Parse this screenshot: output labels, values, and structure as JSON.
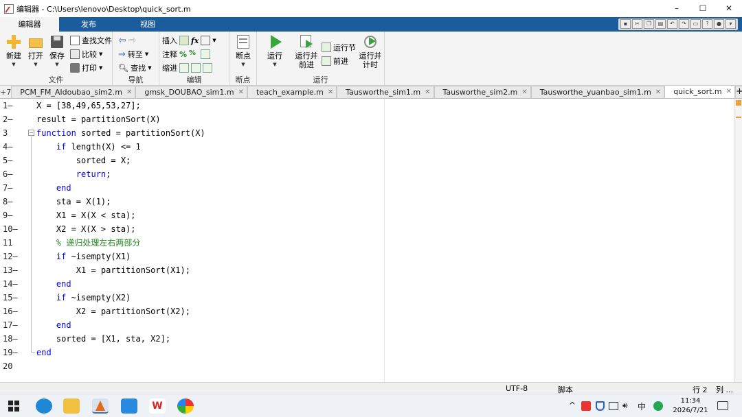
{
  "window": {
    "title": "编辑器 - C:\\Users\\lenovo\\Desktop\\quick_sort.m",
    "minimize": "–",
    "maximize": "☐",
    "close": "✕"
  },
  "ribbon_tabs": [
    {
      "label": "编辑器",
      "active": true
    },
    {
      "label": "发布",
      "active": false
    },
    {
      "label": "视图",
      "active": false
    }
  ],
  "ribbon": {
    "file": {
      "label": "文件",
      "new": "新建",
      "open": "打开",
      "save": "保存",
      "find_files": "查找文件",
      "compare": "比较",
      "print": "打印"
    },
    "navigate": {
      "label": "导航",
      "goto": "转至",
      "find": "查找"
    },
    "edit": {
      "label": "编辑",
      "insert": "插入",
      "comment": "注释",
      "indent": "缩进",
      "fx": "fx",
      "percent": "%"
    },
    "breakpoints": {
      "label": "断点",
      "breakpoint": "断点"
    },
    "run": {
      "label": "运行",
      "run": "运行",
      "run_advance_1": "运行并",
      "run_advance_2": "前进",
      "run_section": "运行节",
      "advance": "前进",
      "run_time_1": "运行并",
      "run_time_2": "计时"
    }
  },
  "doc_tabs": {
    "overflow": "+7",
    "tabs": [
      {
        "label": "PCM_FM_AIdoubao_sim2.m",
        "active": false
      },
      {
        "label": "gmsk_DOUBAO_sim1.m",
        "active": false
      },
      {
        "label": "teach_example.m",
        "active": false
      },
      {
        "label": "Tausworthe_sim1.m",
        "active": false
      },
      {
        "label": "Tausworthe_sim2.m",
        "active": false
      },
      {
        "label": "Tausworthe_yuanbao_sim1.m",
        "active": false
      },
      {
        "label": "quick_sort.m",
        "active": true
      }
    ],
    "new_tab": "+"
  },
  "code_lines": [
    {
      "num": "1",
      "mark": "—",
      "text": "X = [38,49,65,53,27];"
    },
    {
      "num": "2",
      "mark": "—",
      "text": "result = partitionSort(X)"
    },
    {
      "num": "3",
      "mark": "",
      "text": "function sorted = partitionSort(X)"
    },
    {
      "num": "4",
      "mark": "—",
      "text": "    if length(X) <= 1"
    },
    {
      "num": "5",
      "mark": "—",
      "text": "        sorted = X;"
    },
    {
      "num": "6",
      "mark": "—",
      "text": "        return;"
    },
    {
      "num": "7",
      "mark": "—",
      "text": "    end"
    },
    {
      "num": "8",
      "mark": "—",
      "text": "    sta = X(1);"
    },
    {
      "num": "9",
      "mark": "—",
      "text": "    X1 = X(X < sta);"
    },
    {
      "num": "10",
      "mark": "—",
      "text": "    X2 = X(X > sta);"
    },
    {
      "num": "11",
      "mark": "",
      "text": "    % 递归处理左右两部分"
    },
    {
      "num": "12",
      "mark": "—",
      "text": "    if ~isempty(X1)"
    },
    {
      "num": "13",
      "mark": "—",
      "text": "        X1 = partitionSort(X1);"
    },
    {
      "num": "14",
      "mark": "—",
      "text": "    end"
    },
    {
      "num": "15",
      "mark": "—",
      "text": "    if ~isempty(X2)"
    },
    {
      "num": "16",
      "mark": "—",
      "text": "        X2 = partitionSort(X2);"
    },
    {
      "num": "17",
      "mark": "—",
      "text": "    end"
    },
    {
      "num": "18",
      "mark": "—",
      "text": "    sorted = [X1, sta, X2];"
    },
    {
      "num": "19",
      "mark": "—",
      "text": "end"
    },
    {
      "num": "20",
      "mark": "",
      "text": ""
    }
  ],
  "status": {
    "encoding": "UTF-8",
    "script": "脚本",
    "row": "行  2",
    "col": "列 ..."
  },
  "taskbar": {
    "time": "11:34",
    "date": "2026/7/21",
    "ime": "中",
    "tray_up": "^"
  },
  "colors": {
    "ribbon_tab_bar": "#1b5c9c",
    "keyword": "#0000ff",
    "comment": "#228b22"
  }
}
